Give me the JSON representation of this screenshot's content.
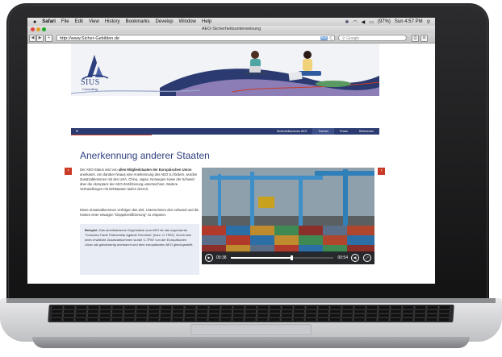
{
  "menubar": {
    "apple": "",
    "items": [
      "Safari",
      "File",
      "Edit",
      "View",
      "History",
      "Bookmarks",
      "Develop",
      "Window",
      "Help"
    ],
    "battery": "(97%)",
    "clock": "Sun 4:57 PM"
  },
  "window": {
    "title": "AEO-Sicherheitsunterweisung"
  },
  "toolbar": {
    "back": "◀",
    "forward": "▶",
    "add": "+",
    "url": "http://www.Sicher-Gebilden.de",
    "rss": "RSS",
    "reload": "C",
    "search_placeholder": "Google"
  },
  "site": {
    "logo_text": "SIUS",
    "logo_sub": "Consulting",
    "nav": [
      "Sicherheitsnormen AEO",
      "Themen",
      "Praxis",
      "Referenzen"
    ],
    "heading": "Anerkennung anderer Staaten",
    "para1_a": "Der AEO-Status wird von ",
    "para1_b": "allen Mitgliedstaaten der Europäischen Union",
    "para1_c": " anerkannt. Um darüber hinaus eine Anerkennung des AEO zu fördern, wurden Zusatzabkommen mit den USA, China, Japan, Norwegen sowie der Schweiz über die Akzeptanz der AEO-Zertifizierung unterzeichnet. Weitere Verhandlungen mit Drittstaaten laufen derzeit.",
    "para2": "Diese Zusatzabkommen verfolgen das Ziel, Unternehmen den Aufwand und die Kosten einer etwaigen \"Doppelzertifizierung\" zu ersparen.",
    "note_label": "Beispiel:",
    "note_text": " Das amerikanische Gegenstück zum AEO ist das sogenannte \"Customs-Trade Partnership Against Terrorism\" (kurz: C-TPAT). Durch das oben erwähnte Zusatzabkommen wurde C-TPAT von der Europäischen Union als gleichwertig anerkannt und dem europäischen AEO gleichgestellt.",
    "prev": "‹",
    "next": "›"
  },
  "video": {
    "time_current": "00:38",
    "time_total": "00:54",
    "progress": 0.58,
    "play": "▶",
    "volume": "◀)",
    "fullscreen": "⤢"
  },
  "colors": {
    "brand_navy": "#2b3b71",
    "accent_red": "#c93a26"
  }
}
